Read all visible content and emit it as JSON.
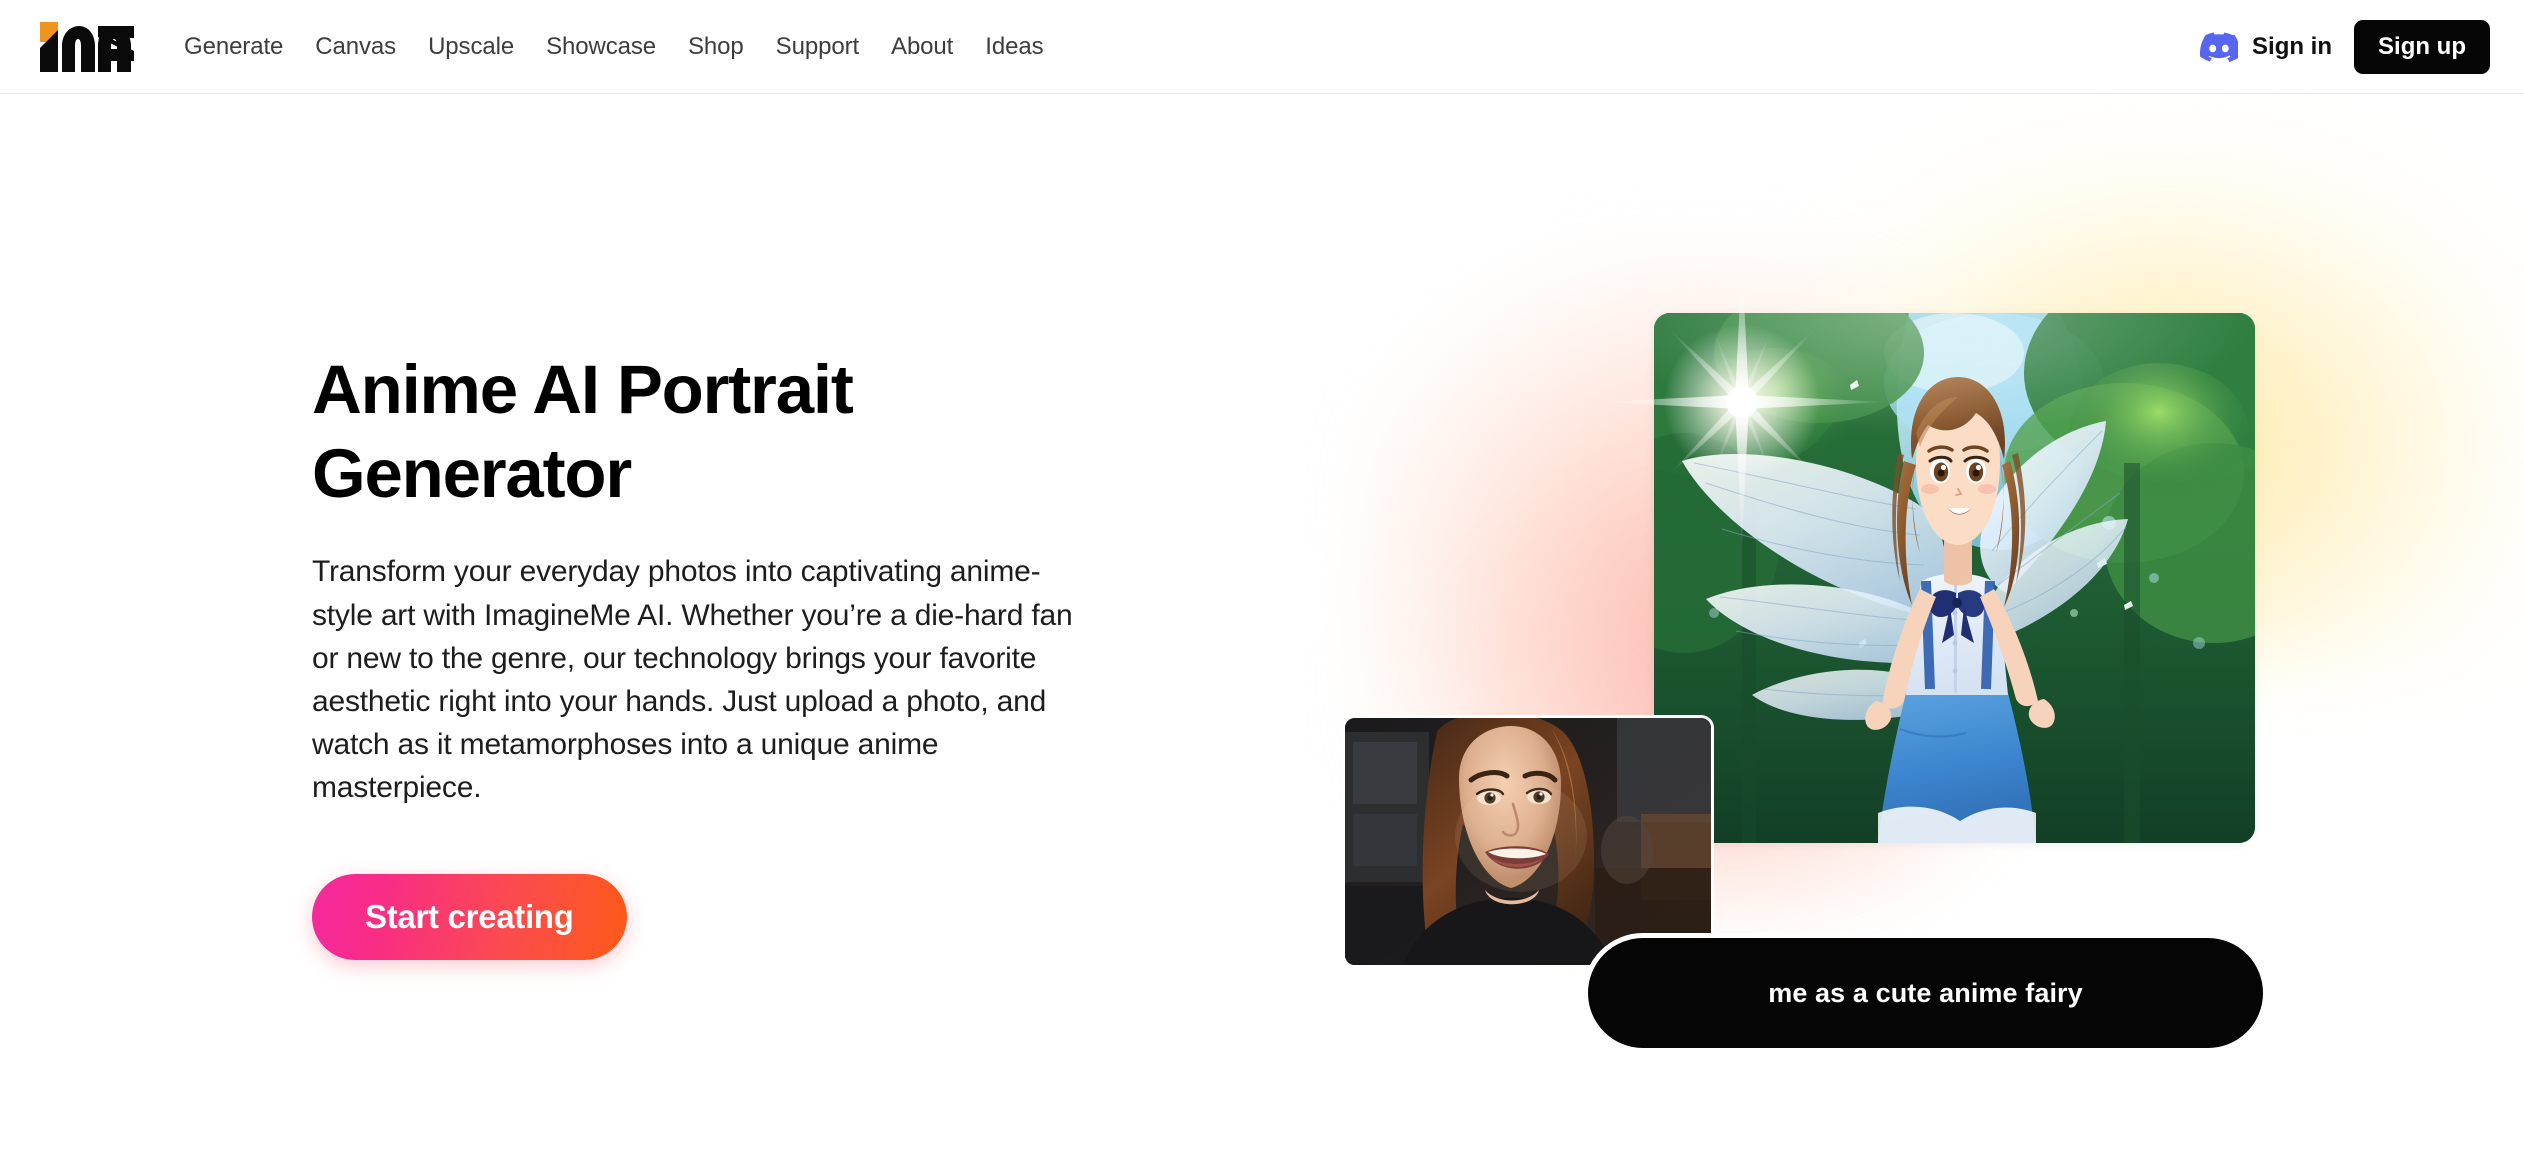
{
  "header": {
    "logo_alt": "ImagineMe logo",
    "logo_accent_color": "#F0941F",
    "logo_color": "#0A0A0A",
    "nav": [
      {
        "label": "Generate"
      },
      {
        "label": "Canvas"
      },
      {
        "label": "Upscale"
      },
      {
        "label": "Showcase"
      },
      {
        "label": "Shop"
      },
      {
        "label": "Support"
      },
      {
        "label": "About"
      },
      {
        "label": "Ideas"
      }
    ],
    "discord_icon": "discord-icon",
    "discord_color": "#5865F2",
    "sign_in_label": "Sign in",
    "sign_up_label": "Sign up",
    "sign_up_bg": "#050505",
    "sign_up_fg": "#FFFFFF"
  },
  "hero": {
    "title": "Anime AI Portrait Generator",
    "description": "Transform your everyday photos into captivating anime-style art with ImagineMe AI. Whether you’re a die-hard fan or new to the genre, our technology brings your favorite aesthetic right into your hands. Just upload a photo, and watch as it metamorphoses into a unique anime masterpiece.",
    "cta_label": "Start creating",
    "cta_gradient_from": "#F5289F",
    "cta_gradient_to": "#FC5A17"
  },
  "visual": {
    "prompt_text": "me as a cute anime fairy",
    "prompt_bg": "#050505",
    "prompt_fg": "#FFFFFF",
    "anime_card_alt": "AI generated anime fairy girl with translucent wings in a sunlit forest",
    "photo_card_alt": "Smiling woman selfie photo used as the source image",
    "sparkle_icon": "sparkle-icon",
    "glow_peach": "#FCA08C",
    "glow_yellow": "#FFE082"
  }
}
